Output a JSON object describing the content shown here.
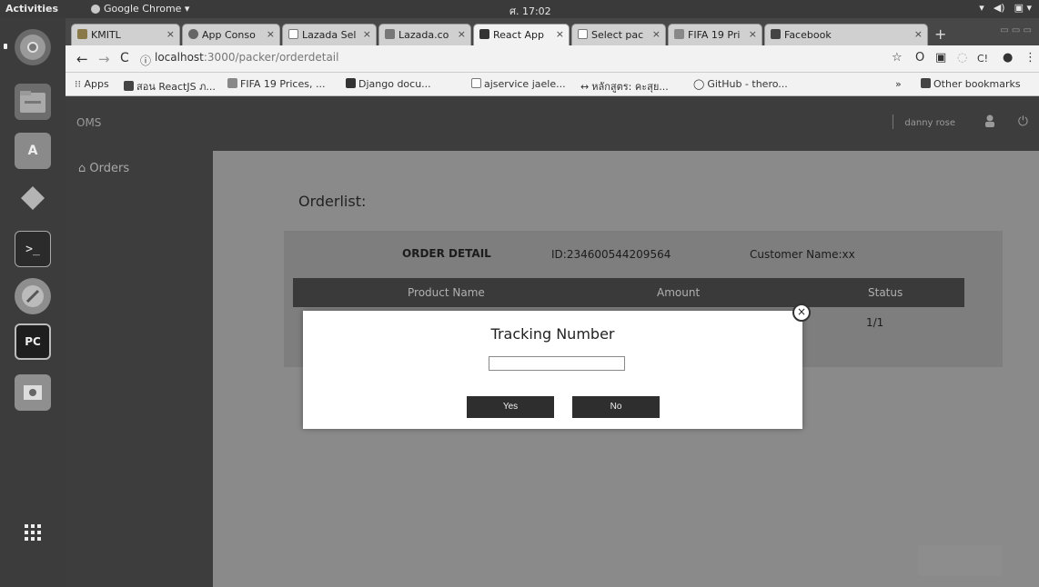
{
  "topbar": {
    "activities": "Activities",
    "app_name": "Google Chrome ▾",
    "clock": "ศ. 17:02",
    "tray": [
      "▾",
      "◀)",
      "▣ ▾"
    ]
  },
  "dock": {
    "items": [
      "chrome-icon",
      "files-icon",
      "software-store-icon",
      "sublime-icon",
      "terminal-icon",
      "inkscape-icon",
      "pycharm-icon",
      "screenshot-icon",
      "apps-grid-icon"
    ]
  },
  "tabs": [
    {
      "label": "KMITL",
      "active": false
    },
    {
      "label": "App Conso",
      "active": false
    },
    {
      "label": "Lazada Sel",
      "active": false
    },
    {
      "label": "Lazada.co",
      "active": false
    },
    {
      "label": "React App",
      "active": true
    },
    {
      "label": "Select pac",
      "active": false
    },
    {
      "label": "FIFA 19 Pri",
      "active": false
    },
    {
      "label": "Facebook",
      "active": false
    }
  ],
  "toolbar": {
    "url_host": "localhost",
    "url_path": ":3000/packer/orderdetail"
  },
  "bookmarks": {
    "items": [
      "Apps",
      "สอน ReactJS ภ...",
      "FIFA 19 Prices, ...",
      "Django docu...",
      "ajservice jaele...",
      "หลักสูตร: คะสุย...",
      "GitHub - thero..."
    ],
    "overflow": "»",
    "other": "Other bookmarks"
  },
  "app": {
    "brand": "OMS",
    "username": "danny rose",
    "sidebar": {
      "orders_label": "Orders"
    },
    "page_title": "Orderlist:",
    "order_detail": {
      "label": "ORDER DETAIL",
      "id": "ID:234600544209564",
      "customer": "Customer Name:xx"
    },
    "table": {
      "headers": [
        "Product Name",
        "Amount",
        "Status"
      ],
      "rows": [
        {
          "status": "1/1"
        }
      ]
    }
  },
  "modal": {
    "title": "Tracking Number",
    "input_value": "",
    "yes_label": "Yes",
    "no_label": "No",
    "close_symbol": "×"
  }
}
